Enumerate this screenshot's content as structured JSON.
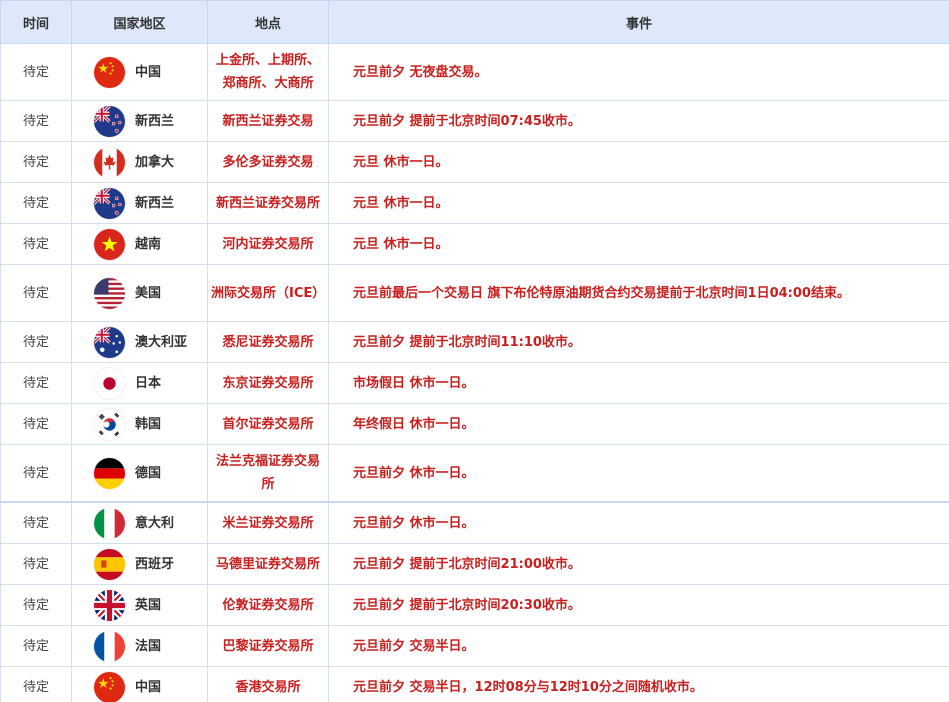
{
  "headers": {
    "time": "时间",
    "region": "国家地区",
    "location": "地点",
    "event": "事件"
  },
  "rows": [
    {
      "time": "待定",
      "flag": "china-flag-icon",
      "country": "中国",
      "location": "上金所、上期所、郑商所、大商所",
      "event": "元旦前夕 无夜盘交易。"
    },
    {
      "time": "待定",
      "flag": "new-zealand-flag-icon",
      "country": "新西兰",
      "location": "新西兰证券交易",
      "event": "元旦前夕 提前于北京时间07:45收市。"
    },
    {
      "time": "待定",
      "flag": "canada-flag-icon",
      "country": "加拿大",
      "location": "多伦多证券交易",
      "event": "元旦 休市一日。"
    },
    {
      "time": "待定",
      "flag": "new-zealand-flag-icon",
      "country": "新西兰",
      "location": "新西兰证券交易所",
      "event": "元旦 休市一日。"
    },
    {
      "time": "待定",
      "flag": "vietnam-flag-icon",
      "country": "越南",
      "location": "河内证券交易所",
      "event": "元旦 休市一日。"
    },
    {
      "time": "待定",
      "flag": "usa-flag-icon",
      "country": "美国",
      "location": "洲际交易所（ICE）",
      "event": "元旦前最后一个交易日 旗下布伦特原油期货合约交易提前于北京时间1日04:00结束。"
    },
    {
      "time": "待定",
      "flag": "australia-flag-icon",
      "country": "澳大利亚",
      "location": "悉尼证券交易所",
      "event": "元旦前夕 提前于北京时间11:10收市。"
    },
    {
      "time": "待定",
      "flag": "japan-flag-icon",
      "country": "日本",
      "location": "东京证券交易所",
      "event": "市场假日 休市一日。"
    },
    {
      "time": "待定",
      "flag": "korea-flag-icon",
      "country": "韩国",
      "location": "首尔证券交易所",
      "event": "年终假日 休市一日。"
    },
    {
      "time": "待定",
      "flag": "germany-flag-icon",
      "country": "德国",
      "location": "法兰克福证券交易所",
      "event": "元旦前夕 休市一日。"
    },
    {
      "time": "待定",
      "flag": "italy-flag-icon",
      "country": "意大利",
      "location": "米兰证券交易所",
      "event": "元旦前夕 休市一日。"
    },
    {
      "time": "待定",
      "flag": "spain-flag-icon",
      "country": "西班牙",
      "location": "马德里证券交易所",
      "event": "元旦前夕 提前于北京时间21:00收市。"
    },
    {
      "time": "待定",
      "flag": "uk-flag-icon",
      "country": "英国",
      "location": "伦敦证券交易所",
      "event": "元旦前夕 提前于北京时间20:30收市。"
    },
    {
      "time": "待定",
      "flag": "france-flag-icon",
      "country": "法国",
      "location": "巴黎证券交易所",
      "event": "元旦前夕 交易半日。"
    },
    {
      "time": "待定",
      "flag": "china-flag-icon",
      "country": "中国",
      "location": "香港交易所",
      "event": "元旦前夕 交易半日，12时08分与12时10分之间随机收市。"
    }
  ],
  "colors": {
    "header_bg": "#dde8fb",
    "accent_red": "#c8201e",
    "border": "#d4deef"
  }
}
